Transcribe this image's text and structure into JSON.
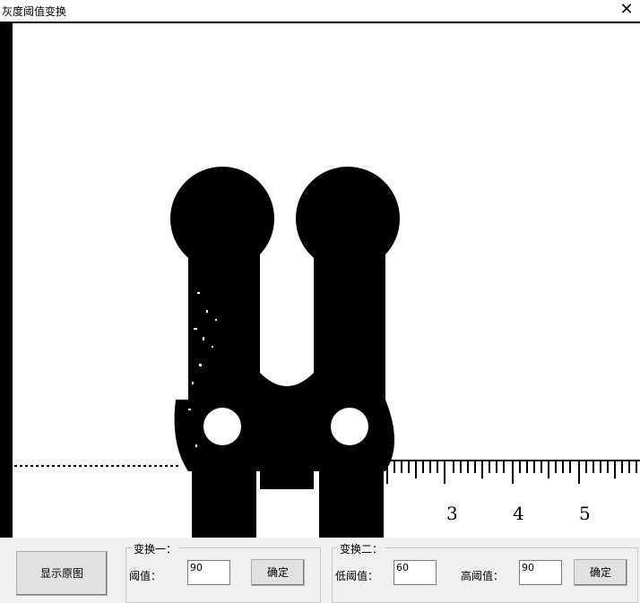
{
  "window": {
    "title": "灰度阈值变换",
    "close_glyph": "✕"
  },
  "image": {
    "description_icon": "binarized-image",
    "ruler_numbers": [
      "3",
      "4",
      "5"
    ]
  },
  "controls": {
    "show_original_label": "显示原图",
    "group1": {
      "title": "变换一：",
      "threshold_label": "阈值：",
      "threshold_value": "90",
      "confirm_label": "确定"
    },
    "group2": {
      "title": "变换二：",
      "low_label": "低阈值：",
      "low_value": "60",
      "high_label": "高阈值：",
      "high_value": "90",
      "confirm_label": "确定"
    }
  },
  "colors": {
    "background": "#f0f0f0",
    "image_fg": "#000000",
    "image_bg": "#ffffff"
  }
}
